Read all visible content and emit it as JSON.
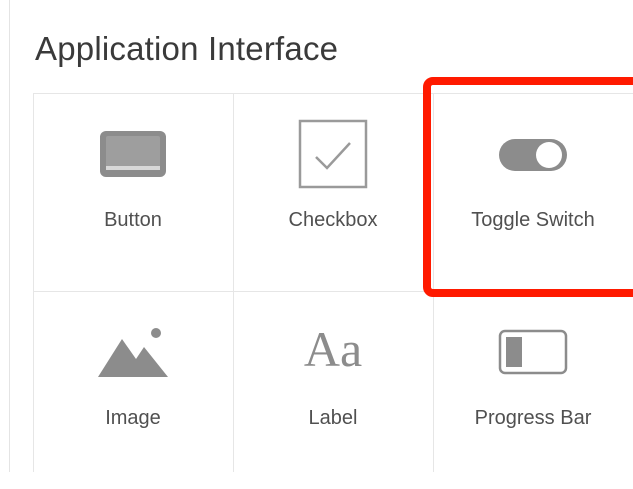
{
  "section": {
    "title": "Application Interface"
  },
  "tiles": [
    {
      "label": "Button",
      "icon": "button-icon"
    },
    {
      "label": "Checkbox",
      "icon": "checkbox-icon"
    },
    {
      "label": "Toggle Switch",
      "icon": "toggle-switch-icon"
    },
    {
      "label": "Image",
      "icon": "image-icon"
    },
    {
      "label": "Label",
      "icon": "label-icon"
    },
    {
      "label": "Progress Bar",
      "icon": "progress-bar-icon"
    }
  ],
  "highlight": {
    "color": "#ff1a00",
    "target": "Toggle Switch"
  },
  "label_icon_text": "Aa"
}
